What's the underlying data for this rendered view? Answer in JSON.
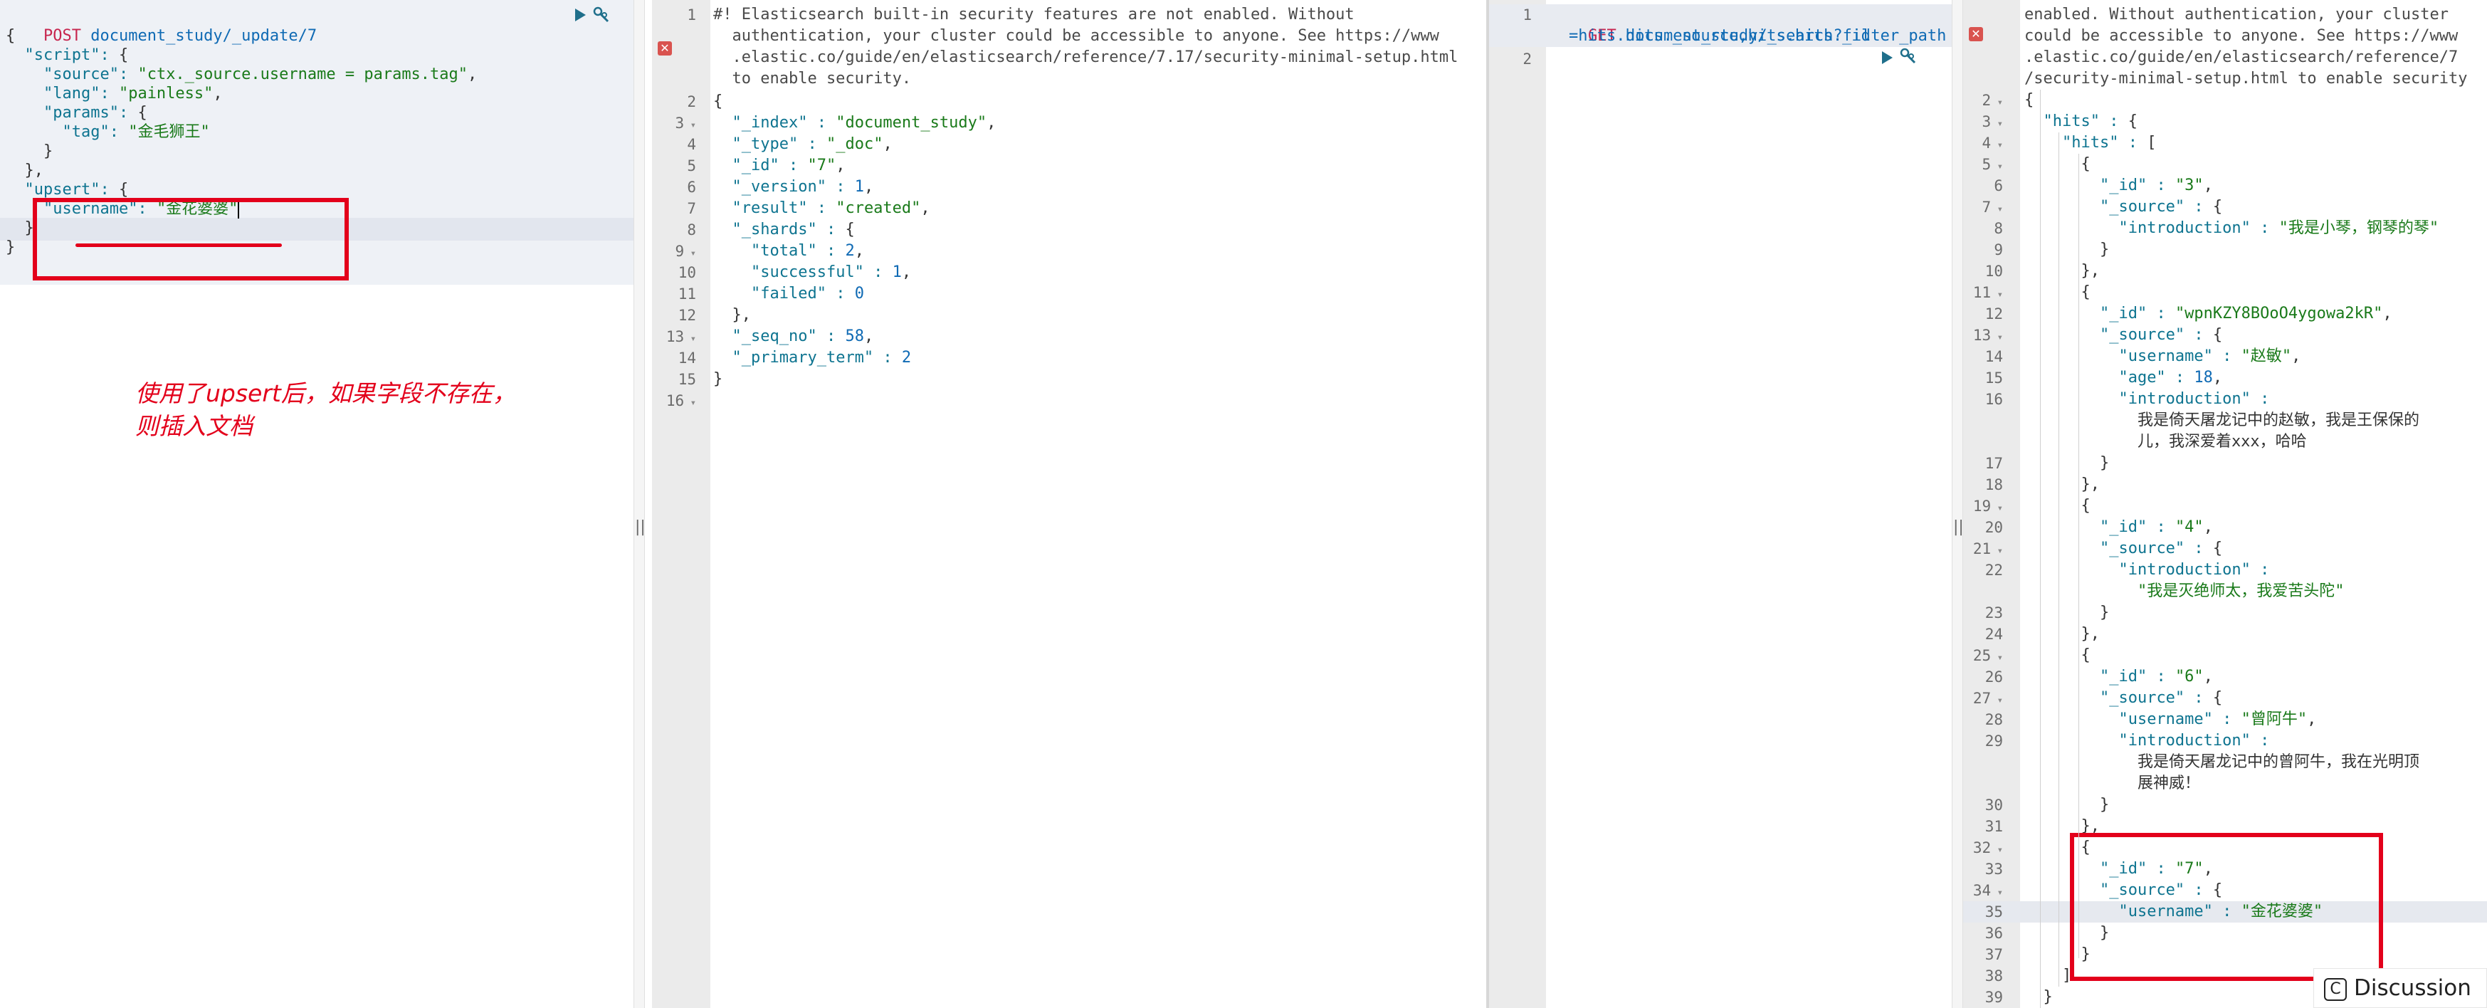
{
  "left_request": {
    "method": "POST",
    "path": "document_study/_update/7",
    "lines": [
      "{",
      "  \"script\": {",
      "    \"source\": \"ctx._source.username = params.tag\",",
      "    \"lang\": \"painless\",",
      "    \"params\": {",
      "      \"tag\": \"金毛狮王\"",
      "    }",
      "  },",
      "  \"upsert\": {",
      "    \"username\": \"金花婆婆\"",
      "  }",
      "}"
    ],
    "annotation_line1": "使用了upsert后，如果字段不存在，",
    "annotation_line2": "则插入文档"
  },
  "left_response": {
    "line_numbers": [
      "1",
      "2",
      "3",
      "4",
      "5",
      "6",
      "7",
      "8",
      "9",
      "10",
      "11",
      "12",
      "13",
      "14",
      "15",
      "16"
    ],
    "warning_lines": [
      "#! Elasticsearch built-in security features are not enabled. Without",
      "  authentication, your cluster could be accessible to anyone. See https://www",
      "  .elastic.co/guide/en/elasticsearch/reference/7.17/security-minimal-setup.html",
      "  to enable security."
    ],
    "body_lines": [
      "{",
      "  \"_index\" : \"document_study\",",
      "  \"_type\" : \"_doc\",",
      "  \"_id\" : \"7\",",
      "  \"_version\" : 1,",
      "  \"result\" : \"created\",",
      "  \"_shards\" : {",
      "    \"total\" : 2,",
      "    \"successful\" : 1,",
      "    \"failed\" : 0",
      "  },",
      "  \"_seq_no\" : 58,",
      "  \"_primary_term\" : 2",
      "}",
      ""
    ]
  },
  "right_request": {
    "line_numbers": [
      "1",
      "2"
    ],
    "method": "GET",
    "path": "document_study/_search?filter_path",
    "path_cont": "=hits.hits._source,hits.hits._id"
  },
  "right_response": {
    "warning_lines": [
      "enabled. Without authentication, your cluster",
      "could be accessible to anyone. See https://www",
      ".elastic.co/guide/en/elasticsearch/reference/7",
      "/security-minimal-setup.html to enable security"
    ],
    "rows": [
      {
        "n": "2",
        "text": "{"
      },
      {
        "n": "3",
        "text": "  \"hits\" : {"
      },
      {
        "n": "4",
        "text": "    \"hits\" : ["
      },
      {
        "n": "5",
        "text": "      {"
      },
      {
        "n": "6",
        "text": "        \"_id\" : \"3\","
      },
      {
        "n": "7",
        "text": "        \"_source\" : {"
      },
      {
        "n": "8",
        "text": "          \"introduction\" : \"我是小琴，钢琴的琴\""
      },
      {
        "n": "9",
        "text": "        }"
      },
      {
        "n": "10",
        "text": "      },"
      },
      {
        "n": "11",
        "text": "      {"
      },
      {
        "n": "12",
        "text": "        \"_id\" : \"wpnKZY8BOoO4ygowa2kR\","
      },
      {
        "n": "13",
        "text": "        \"_source\" : {"
      },
      {
        "n": "14",
        "text": "          \"username\" : \"赵敏\","
      },
      {
        "n": "15",
        "text": "          \"age\" : 18,"
      },
      {
        "n": "16",
        "text": "          \"introduction\" :"
      },
      {
        "n": "",
        "text": "            \"我是倚天屠龙记中的赵敏，我是王保保的"
      },
      {
        "n": "",
        "text": "            儿，我深爱着xxx，哈哈\""
      },
      {
        "n": "17",
        "text": "        }"
      },
      {
        "n": "18",
        "text": "      },"
      },
      {
        "n": "19",
        "text": "      {"
      },
      {
        "n": "20",
        "text": "        \"_id\" : \"4\","
      },
      {
        "n": "21",
        "text": "        \"_source\" : {"
      },
      {
        "n": "22",
        "text": "          \"introduction\" :"
      },
      {
        "n": "",
        "text": "            \"我是灭绝师太，我爱苦头陀\""
      },
      {
        "n": "23",
        "text": "        }"
      },
      {
        "n": "24",
        "text": "      },"
      },
      {
        "n": "25",
        "text": "      {"
      },
      {
        "n": "26",
        "text": "        \"_id\" : \"6\","
      },
      {
        "n": "27",
        "text": "        \"_source\" : {"
      },
      {
        "n": "28",
        "text": "          \"username\" : \"曾阿牛\","
      },
      {
        "n": "29",
        "text": "          \"introduction\" :"
      },
      {
        "n": "",
        "text": "            \"我是倚天屠龙记中的曾阿牛，我在光明顶"
      },
      {
        "n": "",
        "text": "            展神威！\""
      },
      {
        "n": "30",
        "text": "        }"
      },
      {
        "n": "31",
        "text": "      },"
      },
      {
        "n": "32",
        "text": "      {"
      },
      {
        "n": "33",
        "text": "        \"_id\" : \"7\","
      },
      {
        "n": "34",
        "text": "        \"_source\" : {"
      },
      {
        "n": "35",
        "text": "          \"username\" : \"金花婆婆\""
      },
      {
        "n": "36",
        "text": "        }"
      },
      {
        "n": "37",
        "text": "      }"
      },
      {
        "n": "38",
        "text": "    ]"
      },
      {
        "n": "39",
        "text": "  }"
      }
    ]
  },
  "discussion_label": "Discussion",
  "discussion_icon": "C",
  "splitter_glyph": "||",
  "error_glyph": "✕"
}
